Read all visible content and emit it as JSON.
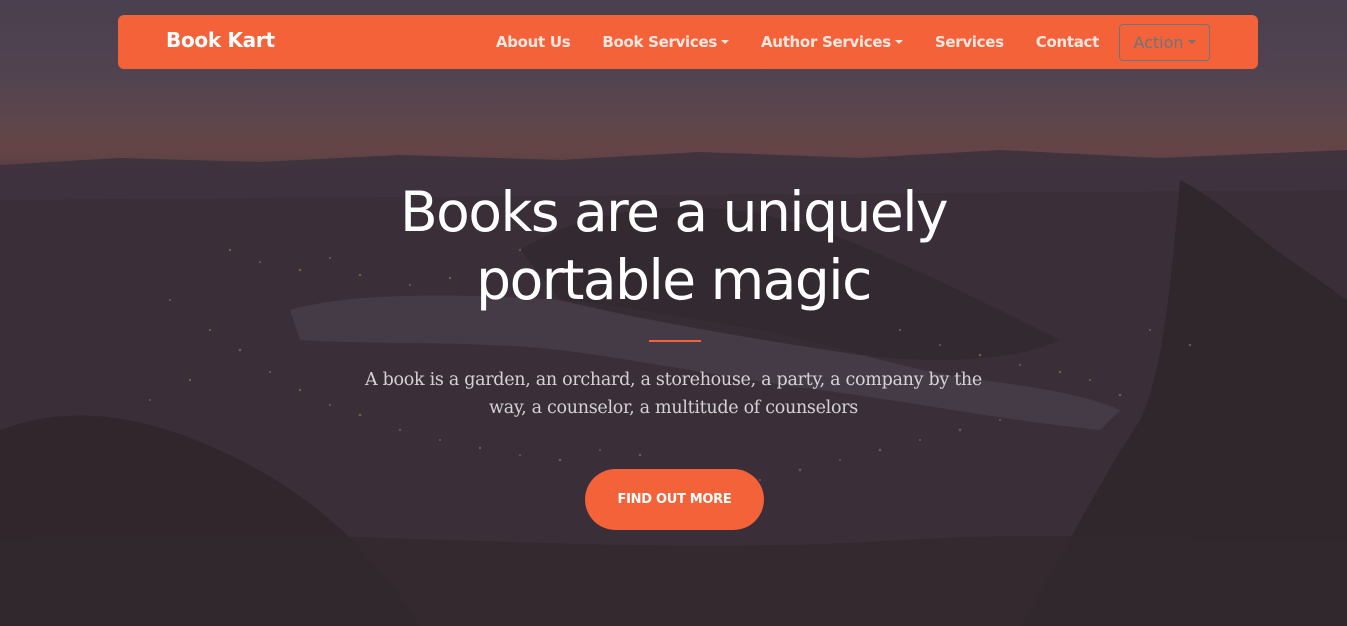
{
  "navbar": {
    "brand": "Book Kart",
    "links": [
      {
        "label": "About Us"
      },
      {
        "label": "Book Services"
      },
      {
        "label": "Author Services"
      },
      {
        "label": "Services"
      },
      {
        "label": "Contact"
      }
    ],
    "action_label": "Action"
  },
  "hero": {
    "headline_line1": "Books are a uniquely",
    "headline_line2": "portable magic",
    "subtext_line1": "A book is a garden, an orchard, a storehouse, a party, a company by the",
    "subtext_line2": "way, a counselor, a multitude of counselors",
    "cta_label": "FIND OUT MORE"
  },
  "colors": {
    "accent": "#f4623a",
    "action_outline": "#6c757d"
  },
  "icons": {
    "dropdown": "caret-down-icon"
  }
}
